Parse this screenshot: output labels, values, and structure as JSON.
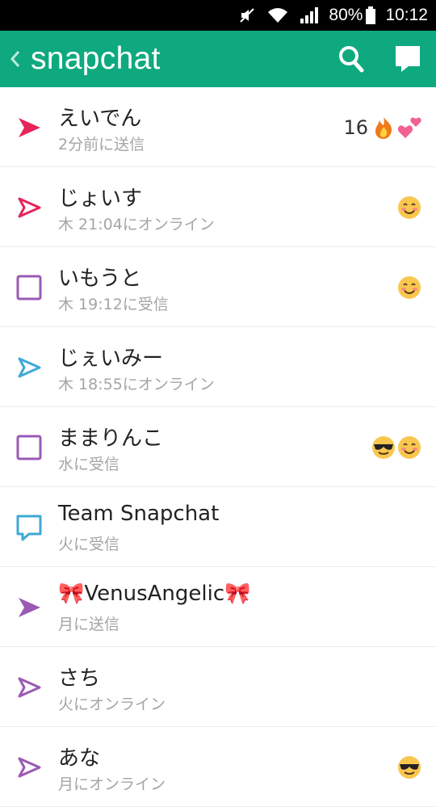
{
  "status_bar": {
    "battery": "80%",
    "time": "10:12"
  },
  "app_bar": {
    "title": "snapchat"
  },
  "colors": {
    "header": "#0ea97f",
    "sent_red": "#e6245a",
    "received_purple": "#9b59b6",
    "blue": "#3fa9d6"
  },
  "chats": [
    {
      "name": "えいでん",
      "status": "2分前に送信",
      "icon": "sent-filled-red",
      "streak": "16",
      "emojis": [
        "fire-emoji",
        "two-hearts-emoji"
      ]
    },
    {
      "name": "じょいす",
      "status": "木 21:04にオンライン",
      "icon": "sent-outline-red",
      "streak": "",
      "emojis": [
        "smile-blush-emoji"
      ]
    },
    {
      "name": "いもうと",
      "status": "木 19:12に受信",
      "icon": "received-outline-purple",
      "streak": "",
      "emojis": [
        "smile-blush-emoji"
      ]
    },
    {
      "name": "じぇいみー",
      "status": "木 18:55にオンライン",
      "icon": "sent-outline-blue",
      "streak": "",
      "emojis": []
    },
    {
      "name": "ままりんこ",
      "status": "水に受信",
      "icon": "received-outline-purple",
      "streak": "",
      "emojis": [
        "sunglasses-emoji",
        "smile-blush-emoji"
      ]
    },
    {
      "name": "Team Snapchat",
      "status": "火に受信",
      "icon": "chat-outline-blue",
      "streak": "",
      "emojis": []
    },
    {
      "name": "🎀VenusAngelic🎀",
      "status": "月に送信",
      "icon": "sent-filled-purple",
      "streak": "",
      "emojis": []
    },
    {
      "name": "さち",
      "status": "火にオンライン",
      "icon": "sent-outline-purple",
      "streak": "",
      "emojis": []
    },
    {
      "name": "あな",
      "status": "月にオンライン",
      "icon": "sent-outline-purple",
      "streak": "",
      "emojis": [
        "sunglasses-emoji"
      ]
    }
  ]
}
